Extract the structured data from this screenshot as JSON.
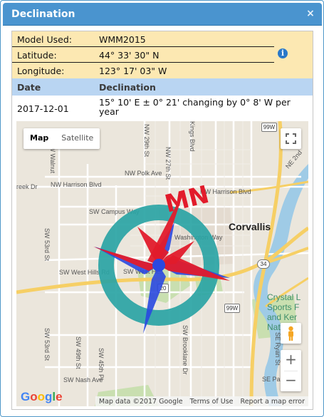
{
  "dialog": {
    "title": "Declination",
    "close_label": "×"
  },
  "info": {
    "model_label": "Model Used:",
    "model_value": "WMM2015",
    "lat_label": "Latitude:",
    "lat_value": "44° 33' 30\" N",
    "lon_label": "Longitude:",
    "lon_value": "123° 17' 03\" W",
    "info_icon": "info-circle-icon"
  },
  "table": {
    "headers": [
      "Date",
      "Declination"
    ],
    "rows": [
      {
        "date": "2017-12-01",
        "declination": "15° 10' E  ± 0° 21'  changing by  0° 8' W per year"
      }
    ]
  },
  "map": {
    "type_options": [
      "Map",
      "Satellite"
    ],
    "selected_type": "Map",
    "city_label": "Corvallis",
    "compass_label": "MN",
    "labels": {
      "harrison1": "NW Harrison Blvd",
      "harrison2": "NW Harrison Blvd",
      "polk": "NW Polk Ave",
      "campus": "SW Campus Way",
      "westhills": "SW West Hills Rd",
      "westh2": "SW West Hi...",
      "nash": "SW Nash Ave",
      "brooklane": "SW Brooklane Dr",
      "park": "SE Park Ave",
      "crystal1": "Crystal L",
      "crystal2": "Sports F",
      "crystal3": "and Ker",
      "crystal4": "Natural",
      "creek": "reek Dr",
      "walnut": "NW Walnut",
      "kings": "Kings Blvd",
      "nw27": "NW 27th St",
      "nw29": "NW 29th St",
      "sw53": "SW 53rd St",
      "sw49": "SW 49th St",
      "sw45": "SW 45th Pl",
      "ne2nd": "NE 2nd",
      "ryan": "SE Ryan St",
      "orst_u": "U",
      "orst_washington": "Washington Way",
      "hw1": "99W",
      "hw2": "99W",
      "hw3": "34",
      "hw4": "20",
      "hw5": "99W"
    },
    "footer": {
      "attribution": "Map data ©2017 Google",
      "terms": "Terms of Use",
      "report": "Report a map error"
    },
    "logo": "Google",
    "zoom_in": "+",
    "zoom_out": "−"
  },
  "colors": {
    "title_bar": "#4a94cf",
    "info_bg": "#fce8b2",
    "table_head_bg": "#b9d5f2",
    "compass_ring": "#2aa4a4",
    "compass_north": "#e21b2b",
    "compass_south": "#2a48e0"
  }
}
